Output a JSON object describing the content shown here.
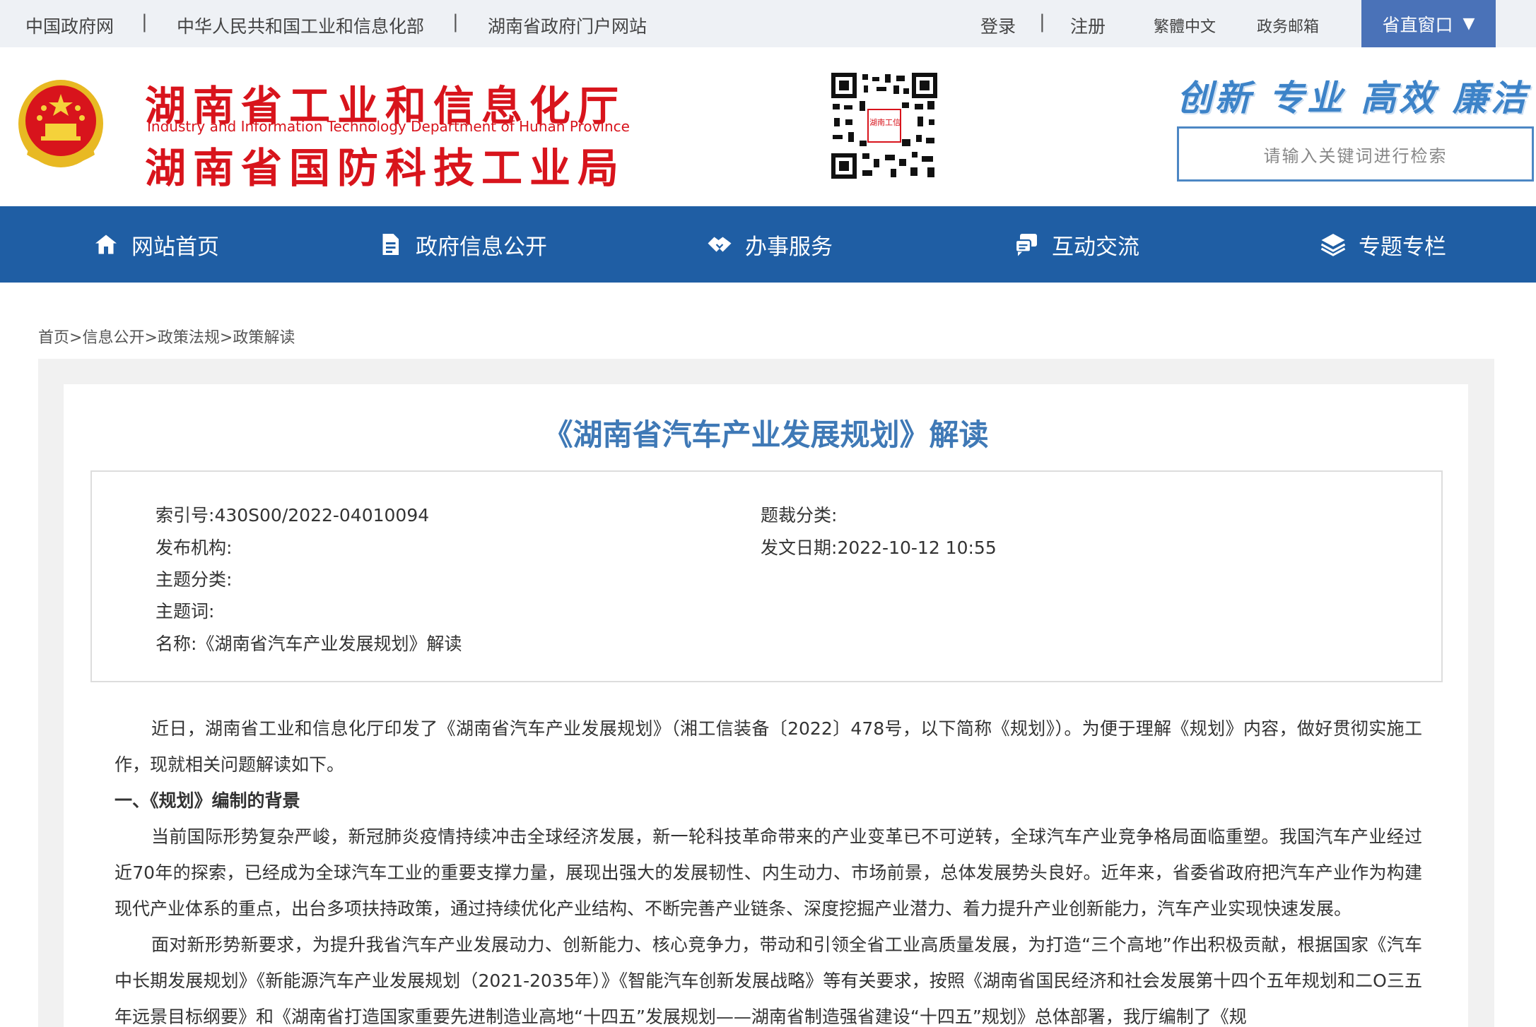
{
  "topbar": {
    "links": [
      "中国政府网",
      "中华人民共和国工业和信息化部",
      "湖南省政府门户网站"
    ],
    "separator": "|",
    "login": "登录",
    "register": "注册",
    "traditional": "繁體中文",
    "mail": "政务邮箱",
    "window_btn": "省直窗口",
    "window_arrow": "▼"
  },
  "header": {
    "title_line1": "湖南省工业和信息化厅",
    "title_en": "Industry and Information Technology Department of Hunan Province",
    "title_line2": "湖南省国防科技工业局",
    "qr_label": "湖南工信",
    "slogan": [
      "创新",
      "专业",
      "高效",
      "廉洁"
    ],
    "search_placeholder": "请输入关键词进行检索"
  },
  "nav": {
    "items": [
      {
        "label": "网站首页",
        "icon": "home-icon"
      },
      {
        "label": "政府信息公开",
        "icon": "document-icon"
      },
      {
        "label": "办事服务",
        "icon": "handshake-icon"
      },
      {
        "label": "互动交流",
        "icon": "chat-icon"
      },
      {
        "label": "专题专栏",
        "icon": "layers-icon"
      }
    ]
  },
  "breadcrumb": {
    "items": [
      "首页",
      "信息公开",
      "政策法规",
      "政策解读"
    ],
    "sep": ">"
  },
  "article": {
    "title": "《湖南省汽车产业发展规划》解读",
    "meta": {
      "index_label": "索引号:",
      "index_value": "430S00/2022-04010094",
      "genre_label": "题裁分类:",
      "genre_value": "",
      "publisher_label": "发布机构:",
      "publisher_value": "",
      "date_label": "发文日期:",
      "date_value": "2022-10-12 10:55",
      "topic_label": "主题分类:",
      "topic_value": "",
      "keyword_label": "主题词:",
      "keyword_value": "",
      "name_label": "名称:",
      "name_value": "《湖南省汽车产业发展规划》解读"
    },
    "para1": "近日，湖南省工业和信息化厅印发了《湖南省汽车产业发展规划》（湘工信装备〔2022〕478号，以下简称《规划》）。为便于理解《规划》内容，做好贯彻实施工作，现就相关问题解读如下。",
    "heading1": "一、《规划》编制的背景",
    "para2": "当前国际形势复杂严峻，新冠肺炎疫情持续冲击全球经济发展，新一轮科技革命带来的产业变革已不可逆转，全球汽车产业竞争格局面临重塑。我国汽车产业经过近70年的探索，已经成为全球汽车工业的重要支撑力量，展现出强大的发展韧性、内生动力、市场前景，总体发展势头良好。近年来，省委省政府把汽车产业作为构建现代产业体系的重点，出台多项扶持政策，通过持续优化产业结构、不断完善产业链条、深度挖掘产业潜力、着力提升产业创新能力，汽车产业实现快速发展。",
    "para3": "面对新形势新要求，为提升我省汽车产业发展动力、创新能力、核心竞争力，带动和引领全省工业高质量发展，为打造“三个高地”作出积极贡献，根据国家《汽车中长期发展规划》《新能源汽车产业发展规划（2021-2035年）》《智能汽车创新发展战略》等有关要求，按照《湖南省国民经济和社会发展第十四个五年规划和二O三五年远景目标纲要》和《湖南省打造国家重要先进制造业高地“十四五”发展规划——湖南省制造强省建设“十四五”规划》总体部署，我厅编制了《规"
  }
}
